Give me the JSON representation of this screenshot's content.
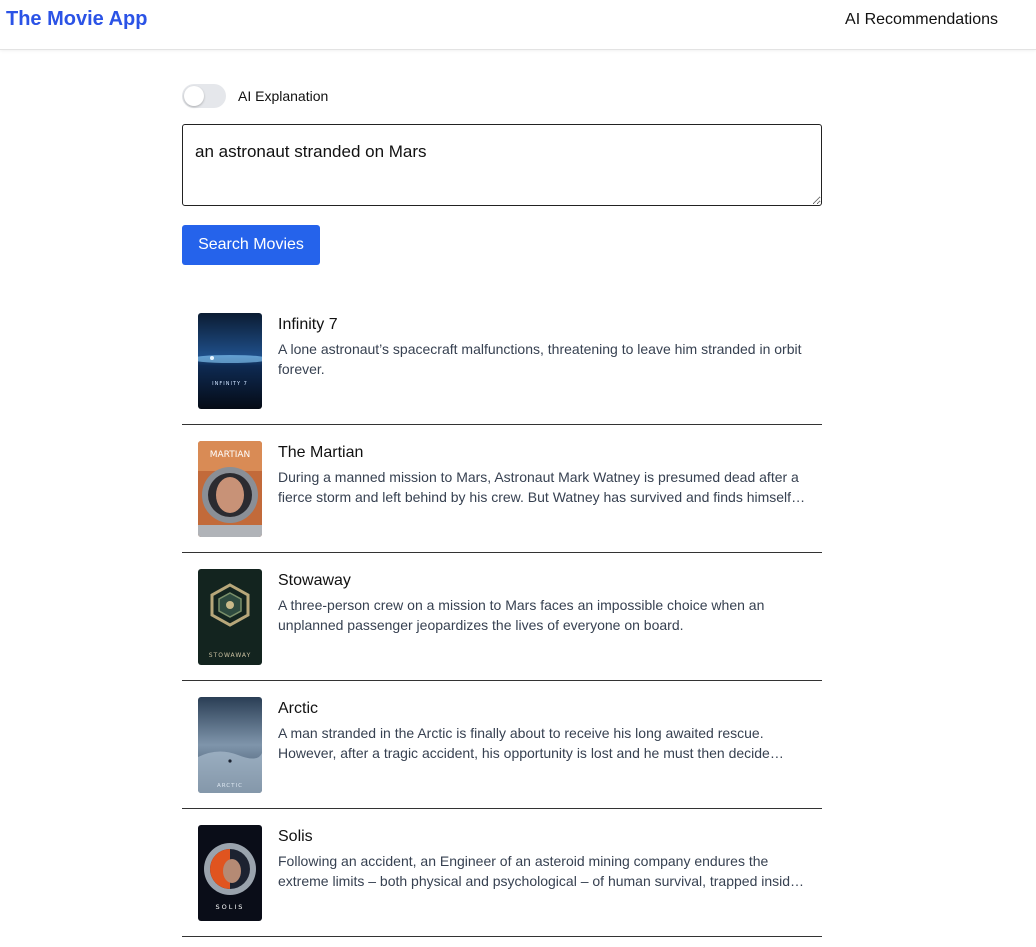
{
  "header": {
    "app_title": "The Movie App",
    "nav_recommendations": "AI Recommendations",
    "brand_color": "#2b53e6"
  },
  "controls": {
    "ai_toggle_label": "AI Explanation",
    "ai_toggle_on": false,
    "query_value": "an astronaut stranded on Mars",
    "search_button_label": "Search Movies",
    "button_color": "#2563eb"
  },
  "results": [
    {
      "title": "Infinity 7",
      "description": "A lone astronaut’s spacecraft malfunctions, threatening to leave him stranded in orbit forever.",
      "poster_text": "INFINITY 7"
    },
    {
      "title": "The Martian",
      "description": "During a manned mission to Mars, Astronaut Mark Watney is presumed dead after a fierce storm and left behind by his crew. But Watney has survived and finds himself stranded and alone on the hostile planet.",
      "poster_text": "MARTIAN"
    },
    {
      "title": "Stowaway",
      "description": "A three-person crew on a mission to Mars faces an impossible choice when an unplanned passenger jeopardizes the lives of everyone on board.",
      "poster_text": "STOWAWAY"
    },
    {
      "title": "Arctic",
      "description": "A man stranded in the Arctic is finally about to receive his long awaited rescue. However, after a tragic accident, his opportunity is lost and he must then decide whether to remain in the relative safety of his makeshift camp or to embark on a deadly trek through the unknown.",
      "poster_text": "ARCTIC"
    },
    {
      "title": "Solis",
      "description": "Following an accident, an Engineer of an asteroid mining company endures the extreme limits – both physical and psychological – of human survival, trapped inside an escape pod hurtling towards the sun.",
      "poster_text": "SOLIS"
    }
  ]
}
